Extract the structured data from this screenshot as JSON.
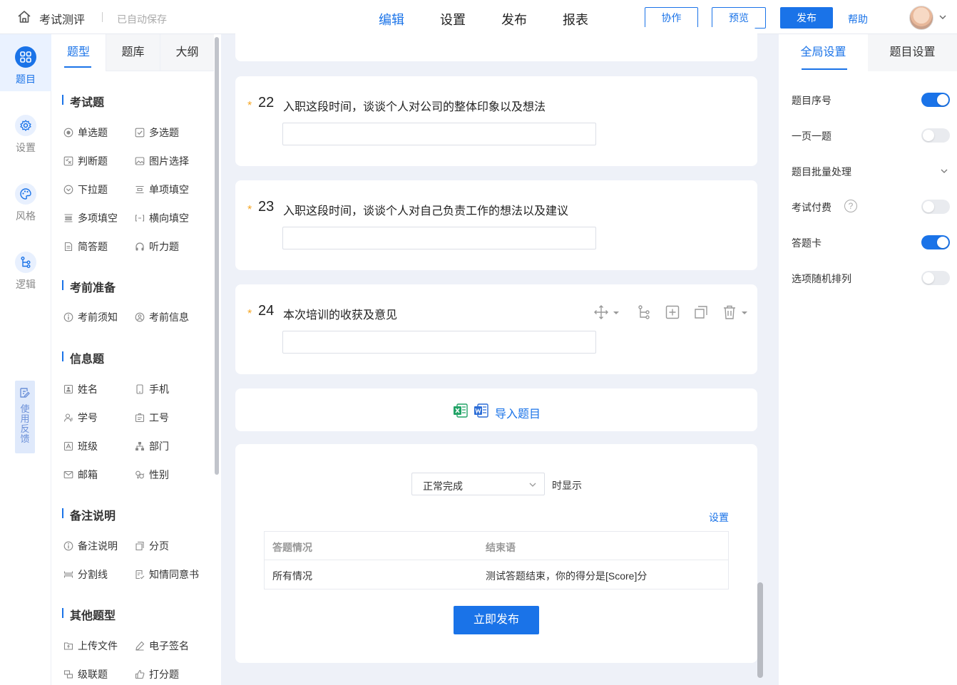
{
  "header": {
    "app_title": "考试测评",
    "autosave": "已自动保存",
    "tabs": [
      {
        "label": "编辑",
        "active": true
      },
      {
        "label": "设置",
        "active": false
      },
      {
        "label": "发布",
        "active": false
      },
      {
        "label": "报表",
        "active": false
      }
    ],
    "collab_label": "协作",
    "preview_label": "预览",
    "publish_label": "发布",
    "help_label": "帮助",
    "accent": "#1a73e8"
  },
  "rail": {
    "items": [
      {
        "label": "题目",
        "icon": "grid-icon",
        "active": true
      },
      {
        "label": "设置",
        "icon": "gear-icon",
        "active": false
      },
      {
        "label": "风格",
        "icon": "palette-icon",
        "active": false
      },
      {
        "label": "逻辑",
        "icon": "logic-icon",
        "active": false
      }
    ],
    "feedback_label": "使用反馈"
  },
  "types_panel": {
    "tabs": [
      "题型",
      "题库",
      "大纲"
    ],
    "groups": [
      {
        "title": "考试题",
        "items": [
          "单选题",
          "多选题",
          "判断题",
          "图片选择",
          "下拉题",
          "单项填空",
          "多项填空",
          "横向填空",
          "简答题",
          "听力题"
        ]
      },
      {
        "title": "考前准备",
        "items": [
          "考前须知",
          "考前信息"
        ]
      },
      {
        "title": "信息题",
        "items": [
          "姓名",
          "手机",
          "学号",
          "工号",
          "班级",
          "部门",
          "邮箱",
          "性别"
        ]
      },
      {
        "title": "备注说明",
        "items": [
          "备注说明",
          "分页",
          "分割线",
          "知情同意书"
        ]
      },
      {
        "title": "其他题型",
        "items": [
          "上传文件",
          "电子签名",
          "级联题",
          "打分题"
        ]
      }
    ]
  },
  "questions": [
    {
      "required": "*",
      "number": "22",
      "title": "入职这段时间，谈谈个人对公司的整体印象以及想法"
    },
    {
      "required": "*",
      "number": "23",
      "title": "入职这段时间，谈谈个人对自己负责工作的想法以及建议"
    },
    {
      "required": "*",
      "number": "24",
      "title": "本次培训的收获及意见"
    }
  ],
  "import": {
    "label": "导入题目"
  },
  "ending": {
    "select_value": "正常完成",
    "show_suffix": "时显示",
    "setting_link": "设置",
    "table_headers": [
      "答题情况",
      "结束语"
    ],
    "rows": [
      [
        "所有情况",
        "测试答题结束，你的得分是[Score]分"
      ]
    ],
    "publish_now": "立即发布"
  },
  "right_panel": {
    "tabs": [
      "全局设置",
      "题目设置"
    ],
    "settings": [
      {
        "label": "题目序号",
        "type": "toggle",
        "on": true
      },
      {
        "label": "一页一题",
        "type": "toggle",
        "on": false
      },
      {
        "label": "题目批量处理",
        "type": "dropdown"
      },
      {
        "label": "考试付费",
        "type": "toggle",
        "on": false,
        "help": "?"
      },
      {
        "label": "答题卡",
        "type": "toggle",
        "on": true
      },
      {
        "label": "选项随机排列",
        "type": "toggle",
        "on": false
      }
    ]
  }
}
